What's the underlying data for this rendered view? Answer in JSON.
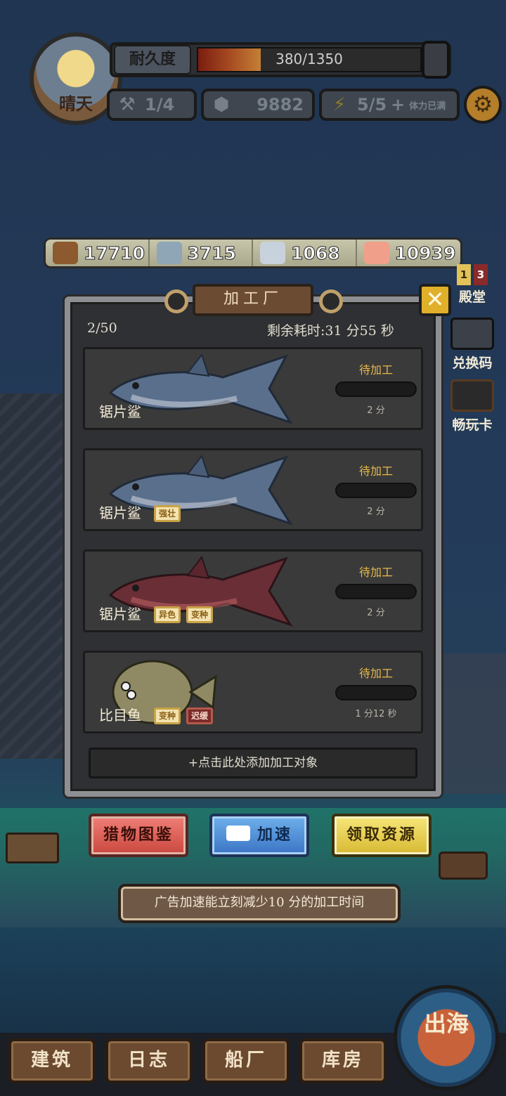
{
  "hud": {
    "weather": "晴天",
    "durability_label": "耐久度",
    "durability_value": "380/1350",
    "durability_fraction": 0.281,
    "tools": "1/4",
    "ore": "9882",
    "energy": "5/5",
    "energy_plus": "+",
    "energy_note": "体力已满"
  },
  "resources": [
    {
      "icon": "wood-log-icon",
      "value": "17710"
    },
    {
      "icon": "fish-can-icon",
      "value": "3715"
    },
    {
      "icon": "iron-ingot-icon",
      "value": "1068"
    },
    {
      "icon": "meat-icon",
      "value": "10939"
    }
  ],
  "side": {
    "hall_label": "殿堂",
    "hall_badge_1": "1",
    "hall_badge_2": "3",
    "redeem_label": "兑换码",
    "pass_label": "畅玩卡"
  },
  "factory": {
    "title": "加工厂",
    "close": "✕",
    "capacity": "2/50",
    "remaining": "剩余耗时:31 分55 秒",
    "add_hint": "+点击此处添加加工对象",
    "items": [
      {
        "name": "锯片鲨",
        "status": "待加工",
        "duration": "2 分",
        "tags": [],
        "progress": 0
      },
      {
        "name": "锯片鲨",
        "status": "待加工",
        "duration": "2 分",
        "tags": [
          "强壮"
        ],
        "progress": 0
      },
      {
        "name": "锯片鲨",
        "status": "待加工",
        "duration": "2 分",
        "tags": [
          "异色",
          "变种"
        ],
        "progress": 0
      },
      {
        "name": "比目鱼",
        "status": "待加工",
        "duration": "1 分12 秒",
        "tags": [
          "变种",
          "迟缓"
        ],
        "progress": 0
      }
    ]
  },
  "actions": {
    "catalog": "猎物图鉴",
    "speed": "加速",
    "collect": "领取资源",
    "ad_banner": "广告加速能立刻减少10 分的加工时间"
  },
  "nav": {
    "build": "建筑",
    "log": "日志",
    "shipyard": "船厂",
    "warehouse": "库房",
    "sail": "出海"
  },
  "colors": {
    "accent_gold": "#e6b84a",
    "panel_bg": "#2f3033",
    "card_bg": "#3a3a3a"
  }
}
